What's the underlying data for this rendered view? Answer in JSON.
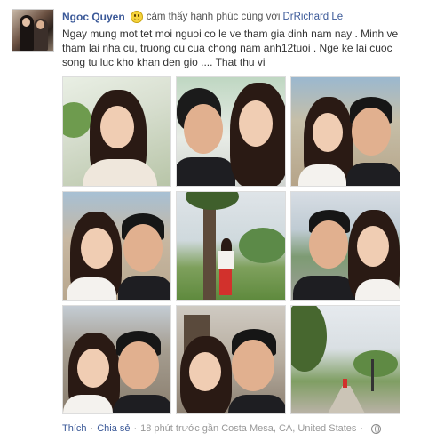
{
  "post": {
    "author": "Ngoc Quyen",
    "feeling_icon": "smiley-icon",
    "feeling_text": "cảm thấy hạnh phúc cùng với",
    "tagged_person": "DrRichard Le",
    "text_lines": [
      "Ngay mung mot tet moi nguoi co le ve tham gia dinh nam nay . Minh ve",
      "tham lai nha cu, truong cu cua chong nam anh12tuoi . Nge ke lai cuoc",
      "song tu luc kho khan den gio .... That thu vi"
    ],
    "photo_count": 9
  },
  "footer": {
    "like_label": "Thích",
    "share_label": "Chia sẻ",
    "time_text": "18 phút trước gần",
    "location": "Costa Mesa, CA, United States",
    "privacy_icon": "globe-icon"
  },
  "colors": {
    "link": "#3b5998",
    "meta": "#999999"
  }
}
